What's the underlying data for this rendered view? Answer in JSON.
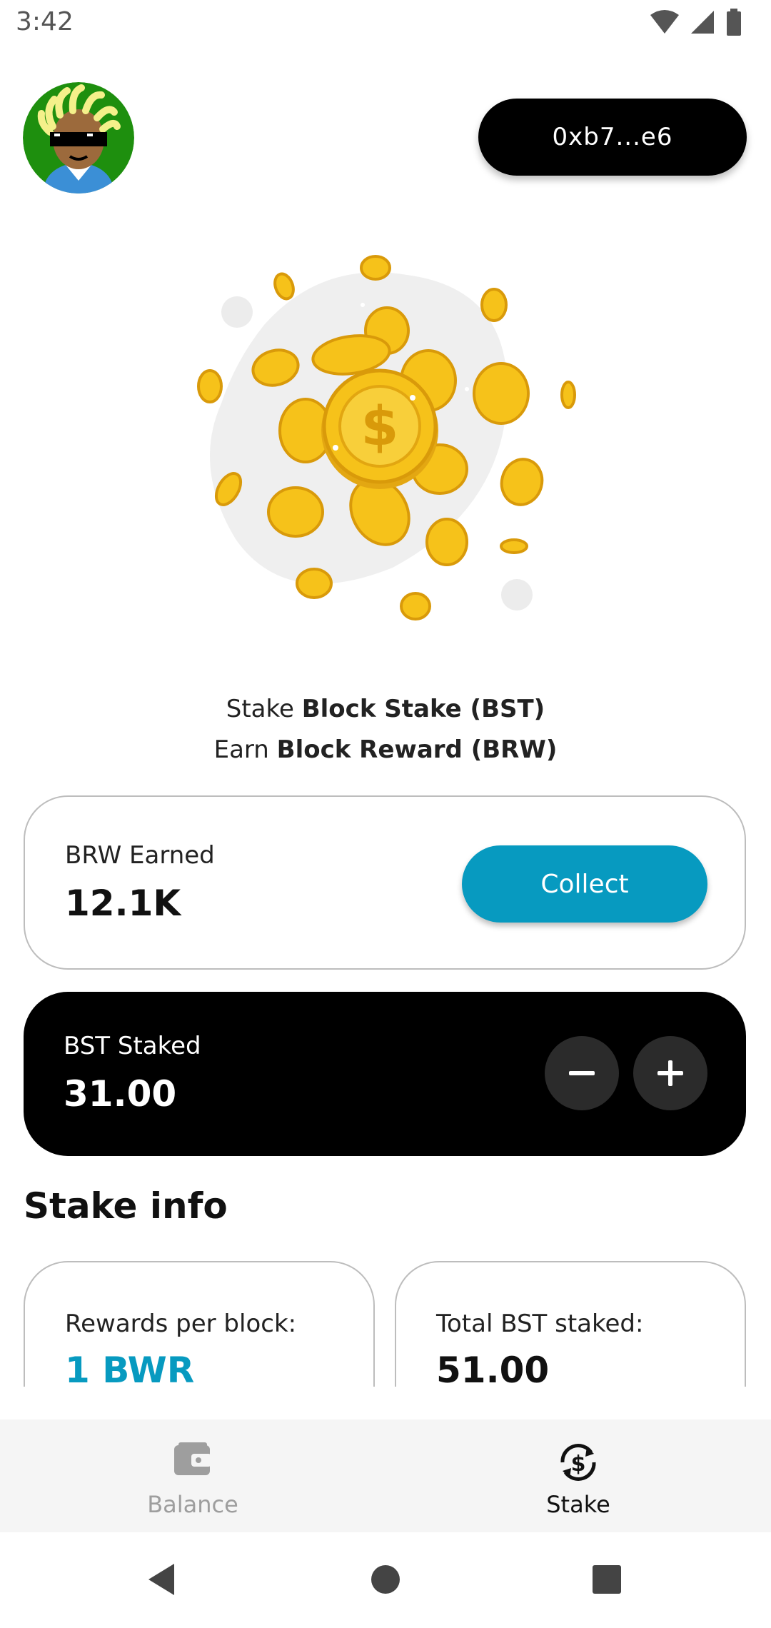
{
  "status_bar": {
    "time": "3:42"
  },
  "header": {
    "wallet_address": "0xb7...e6"
  },
  "headline": {
    "line1_prefix": "Stake",
    "line1_bold": "Block Stake (BST)",
    "line2_prefix": "Earn",
    "line2_bold": "Block Reward (BRW)"
  },
  "earned_card": {
    "label": "BRW Earned",
    "value": "12.1K",
    "collect_label": "Collect"
  },
  "staked_card": {
    "label": "BST Staked",
    "value": "31.00"
  },
  "stake_info": {
    "title": "Stake info",
    "cards": [
      {
        "label": "Rewards per block:",
        "value": "1 BWR"
      },
      {
        "label": "Total BST staked:",
        "value": "51.00"
      }
    ]
  },
  "bottom_nav": {
    "items": [
      {
        "label": "Balance",
        "active": false
      },
      {
        "label": "Stake",
        "active": true
      }
    ]
  },
  "colors": {
    "accent": "#079ac0",
    "dark_card": "#000000",
    "coin": "#f6c21a"
  },
  "icons": [
    "avatar",
    "wifi-icon",
    "signal-icon",
    "battery-icon",
    "coins-illustration",
    "minus-icon",
    "plus-icon",
    "wallet-icon",
    "stake-icon",
    "back-icon",
    "home-icon",
    "recents-icon"
  ]
}
